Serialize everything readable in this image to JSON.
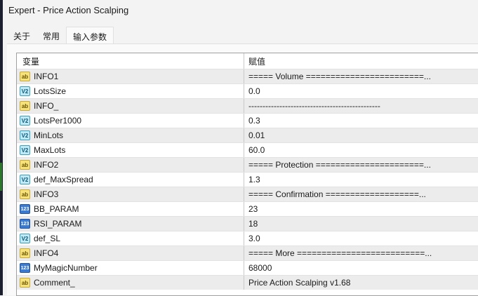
{
  "window": {
    "title": "Expert - Price Action Scalping"
  },
  "tabs": [
    {
      "label": "关于"
    },
    {
      "label": "常用"
    },
    {
      "label": "输入参数"
    }
  ],
  "table": {
    "headers": [
      "变量",
      "赋值"
    ],
    "rows": [
      {
        "type": "ab",
        "icon": "string-icon",
        "name": "INFO1",
        "value": "===== Volume ========================..."
      },
      {
        "type": "dbl",
        "icon": "double-icon",
        "name": "LotsSize",
        "value": "0.0"
      },
      {
        "type": "ab",
        "icon": "string-icon",
        "name": "INFO_",
        "value": "-----------------------------------------------"
      },
      {
        "type": "dbl",
        "icon": "double-icon",
        "name": "LotsPer1000",
        "value": "0.3"
      },
      {
        "type": "dbl",
        "icon": "double-icon",
        "name": "MinLots",
        "value": "0.01"
      },
      {
        "type": "dbl",
        "icon": "double-icon",
        "name": "MaxLots",
        "value": "60.0"
      },
      {
        "type": "ab",
        "icon": "string-icon",
        "name": "INFO2",
        "value": "===== Protection ======================..."
      },
      {
        "type": "dbl",
        "icon": "double-icon",
        "name": "def_MaxSpread",
        "value": "1.3"
      },
      {
        "type": "ab",
        "icon": "string-icon",
        "name": "INFO3",
        "value": "===== Confirmation ===================..."
      },
      {
        "type": "int",
        "icon": "integer-icon",
        "name": "BB_PARAM",
        "value": "23"
      },
      {
        "type": "int",
        "icon": "integer-icon",
        "name": "RSI_PARAM",
        "value": "18"
      },
      {
        "type": "dbl",
        "icon": "double-icon",
        "name": "def_SL",
        "value": "3.0"
      },
      {
        "type": "ab",
        "icon": "string-icon",
        "name": "INFO4",
        "value": "===== More ==========================..."
      },
      {
        "type": "int",
        "icon": "integer-icon",
        "name": "MyMagicNumber",
        "value": "68000"
      },
      {
        "type": "ab",
        "icon": "string-icon",
        "name": "Comment_",
        "value": "Price Action Scalping v1.68"
      }
    ]
  }
}
